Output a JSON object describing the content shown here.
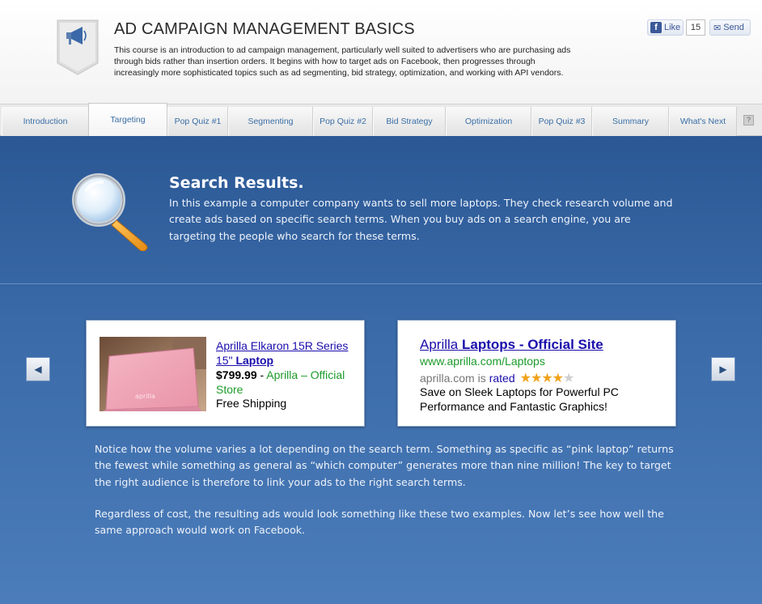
{
  "header": {
    "title": "AD CAMPAIGN MANAGEMENT BASICS",
    "description": "This course is an introduction to ad campaign management, particularly well suited to advertisers who are purchasing ads through bids rather than insertion orders. It begins with how to target ads on Facebook, then progresses through increasingly more sophisticated topics such as ad segmenting, bid strategy, optimization, and working with API vendors.",
    "logo_icon": "megaphone-icon",
    "like_label": "Like",
    "like_count": "15",
    "send_label": "Send"
  },
  "tabs": [
    {
      "label": "Introduction"
    },
    {
      "label": "Targeting",
      "active": true
    },
    {
      "label": "Pop Quiz #1"
    },
    {
      "label": "Segmenting"
    },
    {
      "label": "Pop Quiz #2"
    },
    {
      "label": "Bid Strategy"
    },
    {
      "label": "Optimization"
    },
    {
      "label": "Pop Quiz #3"
    },
    {
      "label": "Summary"
    },
    {
      "label": "What's Next"
    }
  ],
  "help_label": "?",
  "main": {
    "heading": "Search Results.",
    "intro": "In this example a computer company wants to sell more laptops. They check research volume and create ads based on specific search terms. When you buy ads on a search engine, you are targeting the people who search for these terms.",
    "ad1": {
      "title_plain": "Aprilla Elkaron 15R Series 15\"",
      "title_bold": "Laptop",
      "price": "$799.99",
      "separator": " - ",
      "store": "Aprilla – Official Store",
      "shipping": "Free Shipping",
      "image_brand": "aprilla"
    },
    "ad2": {
      "title_plain": "Aprilla",
      "title_bold": "Laptops - Official Site",
      "url": "www.aprilla.com/Laptops",
      "rated_prefix": "aprilla.com is",
      "rated_word": "rated",
      "rating": 4,
      "rating_max": 5,
      "body": "Save on Sleek Laptops for Powerful PC Performance and Fantastic Graphics!"
    },
    "paragraph1": "Notice how the volume varies a lot depending on the search term. Something as specific as “pink laptop” returns the fewest while something as general as “which computer” generates more than nine million! The key to target the right audience is therefore to link your ads to the right search terms.",
    "paragraph2": "Regardless of cost, the resulting ads would look something like these two examples. Now let’s see how well the same approach would work on Facebook."
  },
  "colors": {
    "accent_blue": "#3a6ea5",
    "panel_top": "#2b5895",
    "panel_bottom": "#4c7dbb",
    "ad_link": "#1a0dab",
    "ad_green": "#1c9b2a",
    "star": "#f0a21b"
  }
}
